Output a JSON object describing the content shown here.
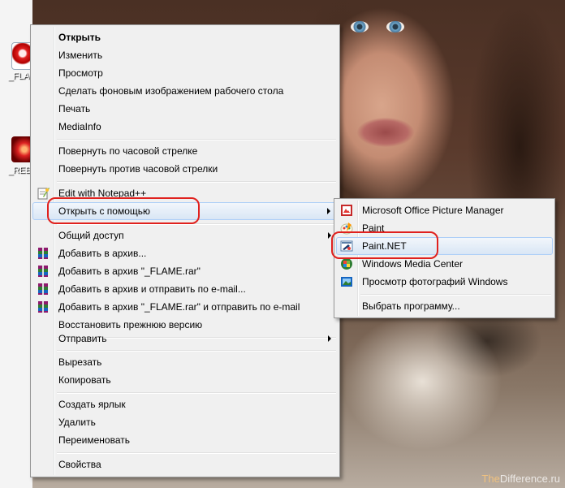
{
  "desktop": {
    "icons": [
      {
        "label": "_FLAME",
        "icon": "flame-image-icon"
      },
      {
        "label": "_REB",
        "icon": "red-image-icon"
      }
    ],
    "watermark": {
      "prefix": "The",
      "text": "Difference.ru"
    }
  },
  "context_menu": {
    "items": [
      {
        "label": "Открыть",
        "bold": true
      },
      {
        "label": "Изменить"
      },
      {
        "label": "Просмотр"
      },
      {
        "label": "Сделать фоновым изображением рабочего стола"
      },
      {
        "label": "Печать"
      },
      {
        "label": "MediaInfo"
      },
      {
        "label": "Повернуть по часовой стрелке"
      },
      {
        "label": "Повернуть против часовой стрелки"
      },
      {
        "label": "Edit with Notepad++",
        "icon": "notepad-plus-plus-icon"
      },
      {
        "label": "Открыть с помощью",
        "submenu": true,
        "highlighted": true
      },
      {
        "label": "Общий доступ",
        "submenu": true
      },
      {
        "label": "Добавить в архив...",
        "icon": "winrar-icon"
      },
      {
        "label": "Добавить в архив \"_FLAME.rar\"",
        "icon": "winrar-icon"
      },
      {
        "label": "Добавить в архив и отправить по e-mail...",
        "icon": "winrar-icon"
      },
      {
        "label": "Добавить в архив \"_FLAME.rar\" и отправить по e-mail",
        "icon": "winrar-icon"
      },
      {
        "label": "Восстановить прежнюю версию"
      },
      {
        "label": "Отправить",
        "submenu": true
      },
      {
        "label": "Вырезать"
      },
      {
        "label": "Копировать"
      },
      {
        "label": "Создать ярлык"
      },
      {
        "label": "Удалить"
      },
      {
        "label": "Переименовать"
      },
      {
        "label": "Свойства"
      }
    ]
  },
  "open_with_submenu": {
    "items": [
      {
        "label": "Microsoft Office Picture Manager",
        "icon": "picture-manager-icon"
      },
      {
        "label": "Paint",
        "icon": "paint-icon"
      },
      {
        "label": "Paint.NET",
        "icon": "paint-net-icon",
        "highlighted": true
      },
      {
        "label": "Windows Media Center",
        "icon": "windows-media-center-icon"
      },
      {
        "label": "Просмотр фотографий Windows",
        "icon": "windows-photo-viewer-icon"
      },
      {
        "label": "Выбрать программу..."
      }
    ]
  },
  "colors": {
    "highlight_ring": "#e0211e",
    "menu_bg": "#f0f0f0",
    "hover_border": "#aecff7"
  }
}
